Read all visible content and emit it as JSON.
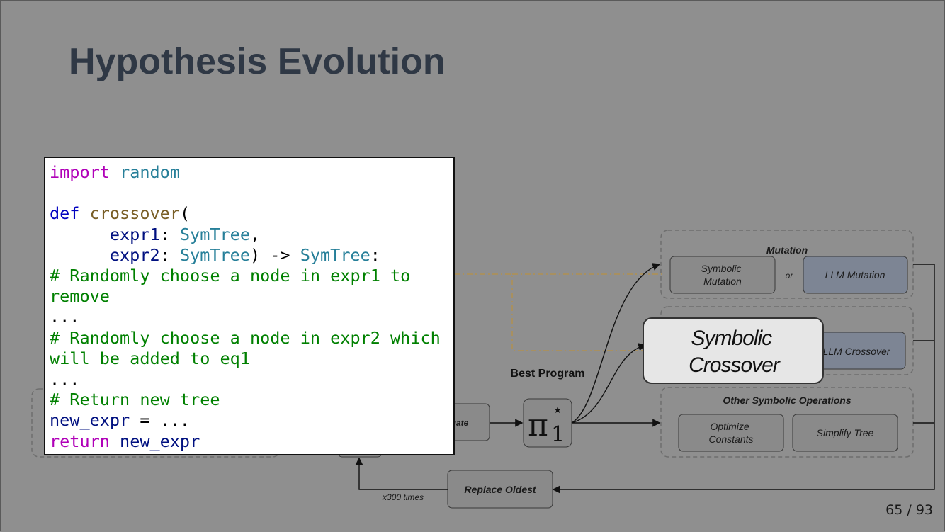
{
  "slide": {
    "title": "Hypothesis Evolution",
    "page_number": "65 / 93"
  },
  "diagram": {
    "mutation_group_label": "Mutation",
    "symbolic_mutation": [
      "Symbolic",
      "Mutation"
    ],
    "or_label": "or",
    "llm_mutation": "LLM Mutation",
    "llm_crossover": "LLM Crossover",
    "symbolic_crossover": [
      "Symbolic",
      "Crossover"
    ],
    "other_ops_group_label": "Other Symbolic Operations",
    "optimize_constants": [
      "Optimize",
      "Constants"
    ],
    "simplify_tree": "Simplify Tree",
    "best_program_label": "Best Program",
    "best_program_symbol": "π",
    "best_program_superscript": "⋆",
    "best_program_subscript": "1",
    "evaluate_partial": "uate",
    "replace_oldest": "Replace Oldest",
    "loop_label": "x300 times",
    "colors": {
      "background": "#8f8f8f",
      "box": "#8a8a8a",
      "llm_box": "#7d8594",
      "highlight": "#e6e6e6",
      "title": "#2f3845"
    }
  },
  "code": {
    "lines": [
      {
        "tokens": [
          {
            "t": "kw",
            "v": "import"
          },
          {
            "t": "plain",
            "v": " "
          },
          {
            "t": "mod",
            "v": "random"
          }
        ]
      },
      {
        "tokens": [
          {
            "t": "plain",
            "v": " "
          }
        ]
      },
      {
        "tokens": [
          {
            "t": "kwd",
            "v": "def"
          },
          {
            "t": "plain",
            "v": " "
          },
          {
            "t": "fn",
            "v": "crossover"
          },
          {
            "t": "plain",
            "v": "("
          }
        ]
      },
      {
        "tokens": [
          {
            "t": "plain",
            "v": "      "
          },
          {
            "t": "param",
            "v": "expr1"
          },
          {
            "t": "plain",
            "v": ": "
          },
          {
            "t": "typ",
            "v": "SymTree"
          },
          {
            "t": "plain",
            "v": ","
          }
        ]
      },
      {
        "tokens": [
          {
            "t": "plain",
            "v": "      "
          },
          {
            "t": "param",
            "v": "expr2"
          },
          {
            "t": "plain",
            "v": ": "
          },
          {
            "t": "typ",
            "v": "SymTree"
          },
          {
            "t": "plain",
            "v": ") -> "
          },
          {
            "t": "typ",
            "v": "SymTree"
          },
          {
            "t": "plain",
            "v": ":"
          }
        ]
      },
      {
        "tokens": [
          {
            "t": "cm",
            "v": "# Randomly choose a node in expr1 to remove"
          }
        ]
      },
      {
        "tokens": [
          {
            "t": "plain",
            "v": "..."
          }
        ]
      },
      {
        "tokens": [
          {
            "t": "cm",
            "v": "# Randomly choose a node in expr2 which will be added to eq1"
          }
        ]
      },
      {
        "tokens": [
          {
            "t": "plain",
            "v": "..."
          }
        ]
      },
      {
        "tokens": [
          {
            "t": "cm",
            "v": "# Return new tree"
          }
        ]
      },
      {
        "tokens": [
          {
            "t": "param",
            "v": "new_expr"
          },
          {
            "t": "plain",
            "v": " = ..."
          }
        ]
      },
      {
        "tokens": [
          {
            "t": "kw",
            "v": "return"
          },
          {
            "t": "plain",
            "v": " "
          },
          {
            "t": "param",
            "v": "new_expr"
          }
        ]
      }
    ]
  }
}
